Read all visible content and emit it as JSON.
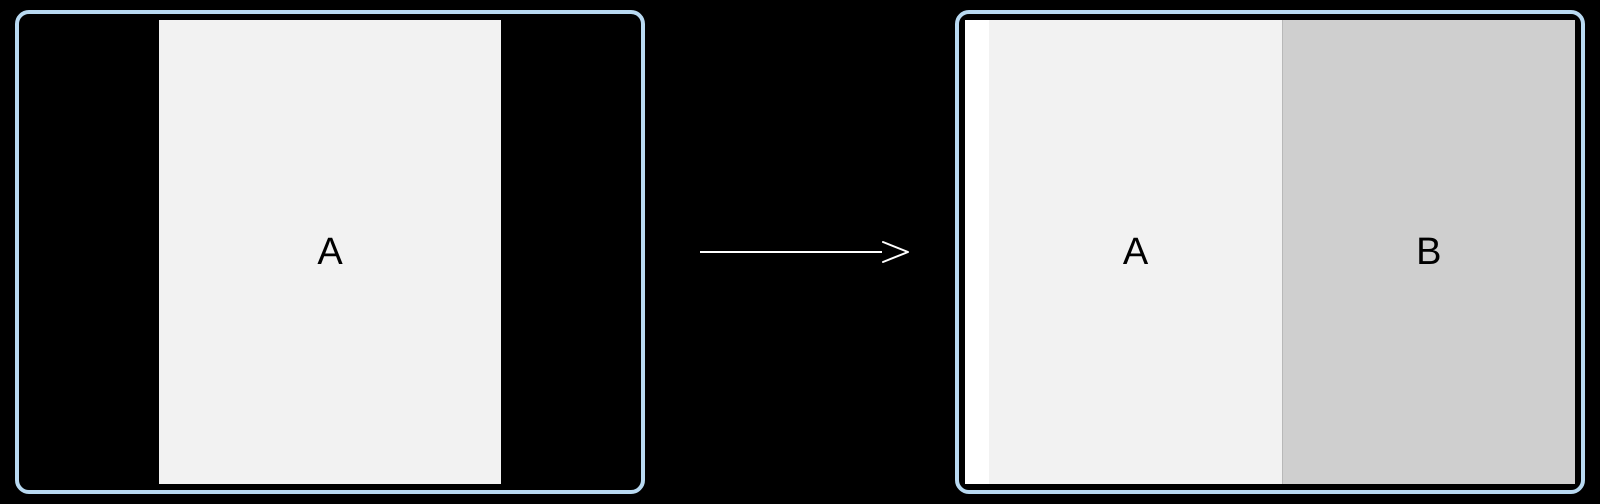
{
  "left_frame": {
    "label_a": "A"
  },
  "right_frame": {
    "label_a": "A",
    "label_b": "B"
  },
  "colors": {
    "frame_border": "#b9daf2",
    "background": "#000000",
    "pane_light": "#f2f2f2",
    "pane_medium": "#cfcfcf",
    "arrow": "#ffffff"
  }
}
